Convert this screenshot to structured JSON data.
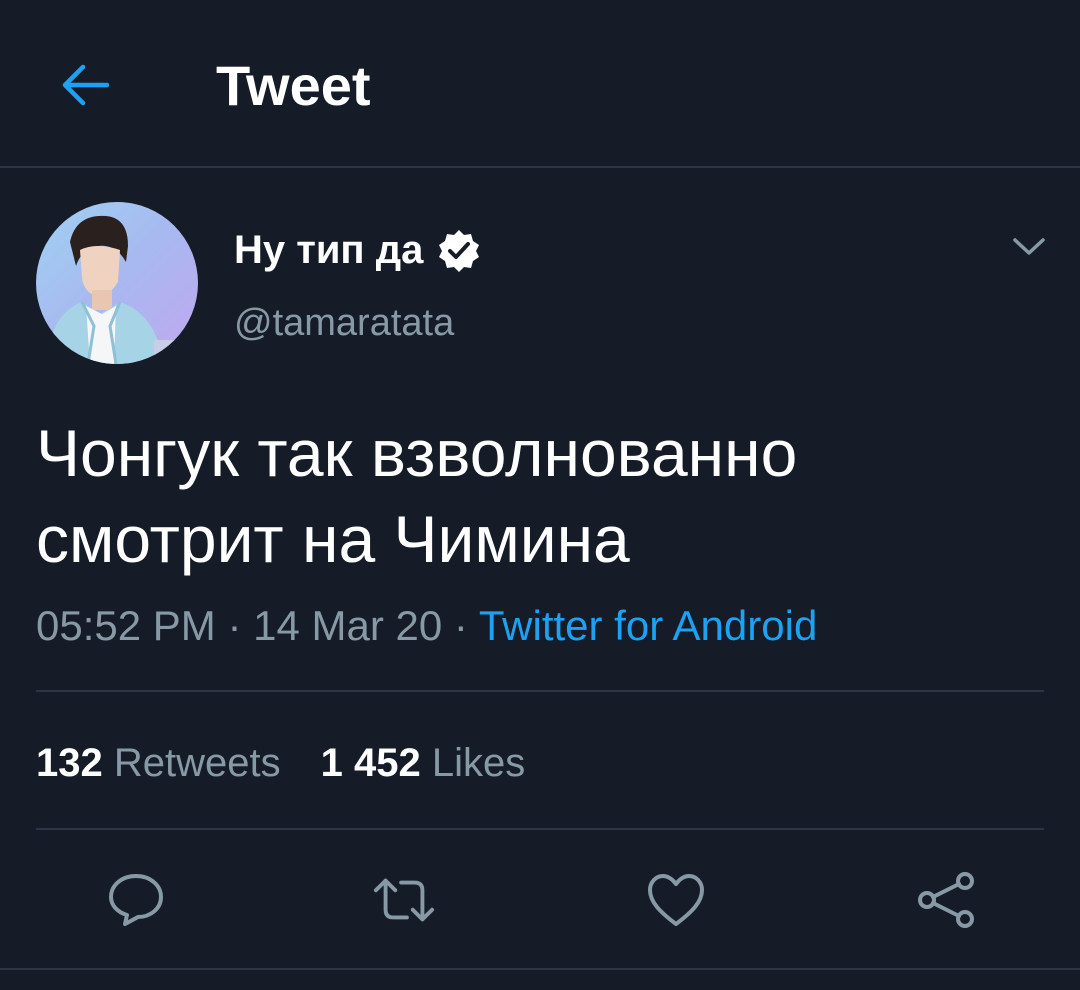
{
  "header": {
    "title": "Tweet",
    "back_icon": "arrow-left-icon"
  },
  "author": {
    "display_name": "Ну тип да",
    "handle": "@tamaratata",
    "verified": true
  },
  "tweet": {
    "text": "Чонгук так взволнованно\nсмотрит на Чимина",
    "time": "05:52 PM",
    "date": "14 Mar 20",
    "separator": "·",
    "source": "Twitter for Android"
  },
  "stats": {
    "retweets_count": "132",
    "retweets_label": "Retweets",
    "likes_count": "1 452",
    "likes_label": "Likes"
  },
  "actions": [
    "reply-icon",
    "retweet-icon",
    "like-icon",
    "share-icon"
  ],
  "colors": {
    "background": "#151c28",
    "accent": "#1da1f2",
    "secondary_text": "#8899a6",
    "divider": "#2c3644"
  }
}
